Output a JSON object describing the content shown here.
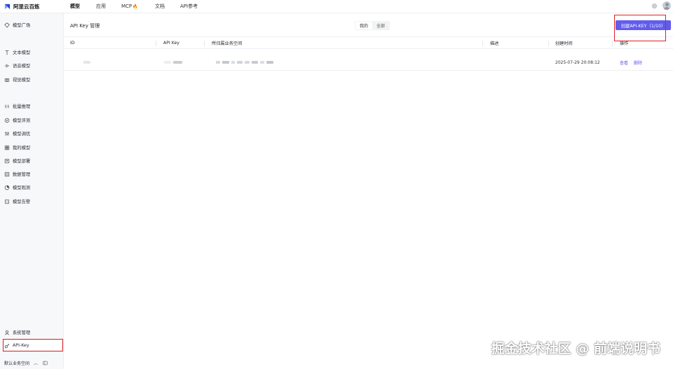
{
  "brand": {
    "name": "阿里云百炼"
  },
  "topnav": {
    "items": [
      {
        "label": "模型"
      },
      {
        "label": "应用"
      },
      {
        "label": "MCP"
      },
      {
        "label": "文档"
      },
      {
        "label": "API参考"
      }
    ]
  },
  "sidebar": {
    "items": [
      {
        "label": "模型广场"
      },
      {
        "label": "文本模型"
      },
      {
        "label": "语音模型"
      },
      {
        "label": "视觉模型"
      },
      {
        "label": "批量推理"
      },
      {
        "label": "模型评测"
      },
      {
        "label": "模型调优"
      },
      {
        "label": "我的模型"
      },
      {
        "label": "模型部署"
      },
      {
        "label": "数据管理"
      },
      {
        "label": "模型观测"
      },
      {
        "label": "模型告警"
      },
      {
        "label": "系统管理"
      },
      {
        "label": "API-Key"
      }
    ],
    "workspace_label": "默认业务空间"
  },
  "page": {
    "title": "API Key 管理",
    "filter": {
      "mine": "我的",
      "all": "全部"
    },
    "create_button": "创建API-KEY（1/10）"
  },
  "table": {
    "columns": [
      "ID",
      "API Key",
      "所归属业务空间",
      "描述",
      "创建时间",
      "操作"
    ],
    "rows": [
      {
        "created": "2025-07-29 20:08:12",
        "view": "查看",
        "delete": "删除"
      }
    ]
  },
  "watermark": "掘金技术社区 @ 前端说明书",
  "colors": {
    "accent": "#615ced",
    "highlight": "#e02020"
  }
}
